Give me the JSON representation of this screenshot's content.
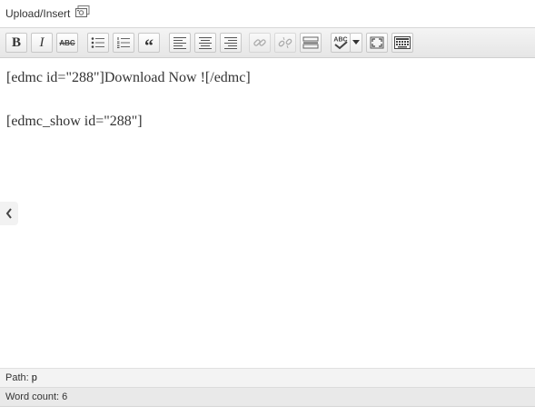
{
  "upload": {
    "label": "Upload/Insert",
    "icon": "add-media-icon"
  },
  "toolbar": {
    "bold": "B",
    "italic": "I",
    "strikethrough": "ABC",
    "blockquote": "“",
    "spellcheck": "ABC",
    "buttons": [
      "bold",
      "italic",
      "strikethrough",
      "bullet-list",
      "numbered-list",
      "blockquote",
      "align-left",
      "align-center",
      "align-right",
      "insert-link",
      "remove-link",
      "insert-more-tag",
      "spellcheck",
      "spellcheck-dropdown",
      "fullscreen",
      "kitchen-sink"
    ]
  },
  "content": {
    "line1": "[edmc id=\"288\"]Download Now ![/edmc]",
    "line2": "[edmc_show id=\"288\"]"
  },
  "status": {
    "path_label": "Path:",
    "path_value": "p",
    "word_count_label": "Word count:",
    "word_count_value": "6"
  },
  "colors": {
    "toolbar_bg": "#e9e9e9",
    "button_border": "#c8c8c8",
    "status_bg": "#f3f3f3",
    "text": "#333333"
  }
}
